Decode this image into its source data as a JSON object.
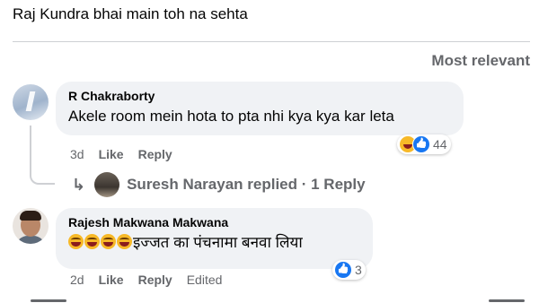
{
  "post": {
    "caption": "Raj Kundra bhai main toh na sehta"
  },
  "sort": {
    "label": "Most relevant"
  },
  "comments": [
    {
      "author": "R Chakraborty",
      "text": "Akele room mein hota to pta nhi kya kya kar leta",
      "time": "3d",
      "like_label": "Like",
      "reply_label": "Reply",
      "reactions": [
        "haha-icon",
        "like-icon"
      ],
      "reaction_count": "44",
      "replies": {
        "replier": "Suresh Narayan",
        "summary": "Suresh Narayan replied · 1 Reply"
      }
    },
    {
      "author": "Rajesh Makwana Makwana",
      "text": "इज्जत का पंचनामा बनवा लिया",
      "time": "2d",
      "like_label": "Like",
      "reply_label": "Reply",
      "edited_label": "Edited",
      "reactions": [
        "like-icon"
      ],
      "reaction_count": "3"
    }
  ],
  "colors": {
    "bubble": "#f0f2f5",
    "secondary_text": "#65676b",
    "like_blue": "#1877f2",
    "haha_yellow": "#f7b928"
  }
}
